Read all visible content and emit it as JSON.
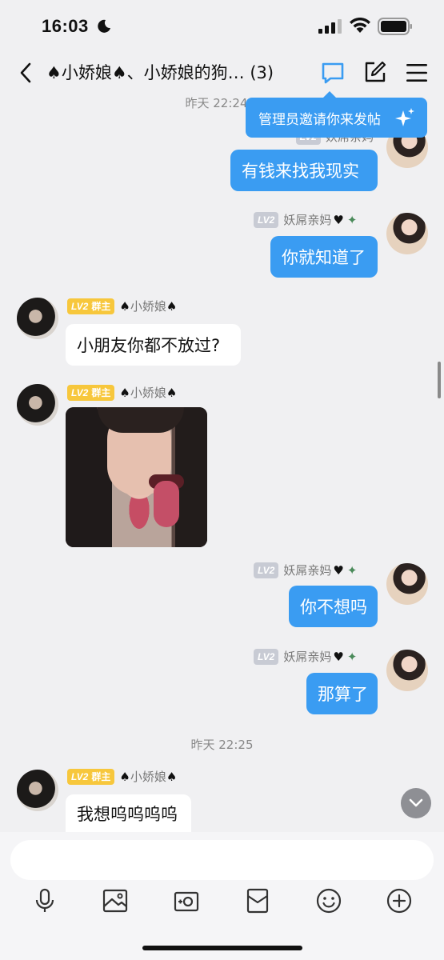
{
  "status_bar": {
    "time": "16:03"
  },
  "nav": {
    "title": "♠小娇娘♠、小娇娘的狗… (3)"
  },
  "tooltip": {
    "text": "管理员邀请你来发帖"
  },
  "timestamps": [
    "昨天 22:24",
    "昨天 22:25"
  ],
  "partial_sender": "妖屌亲妈",
  "messages": [
    {
      "side": "right",
      "level": "LV2",
      "sender": "妖屌亲妈",
      "text": "有钱来找我现实"
    },
    {
      "side": "right",
      "level": "LV2",
      "sender": "妖屌亲妈",
      "text": "你就知道了"
    },
    {
      "side": "left",
      "level": "LV2",
      "role": "群主",
      "sender": "小娇娘",
      "text": "小朋友你都不放过?"
    },
    {
      "side": "left",
      "level": "LV2",
      "role": "群主",
      "sender": "小娇娘",
      "type": "image"
    },
    {
      "side": "right",
      "level": "LV2",
      "sender": "妖屌亲妈",
      "text": "你不想吗"
    },
    {
      "side": "right",
      "level": "LV2",
      "sender": "妖屌亲妈",
      "text": "那算了"
    },
    {
      "side": "left",
      "level": "LV2",
      "role": "群主",
      "sender": "小娇娘",
      "text": "我想呜呜呜呜"
    }
  ],
  "input": {
    "value": "",
    "placeholder": ""
  },
  "toolbar": [
    "microphone-icon",
    "image-icon",
    "camera-icon",
    "red-packet-icon",
    "emoji-icon",
    "plus-icon"
  ],
  "colors": {
    "accent": "#3a9cf2",
    "gold": "#f7c73c",
    "background": "#f0f0f2"
  }
}
